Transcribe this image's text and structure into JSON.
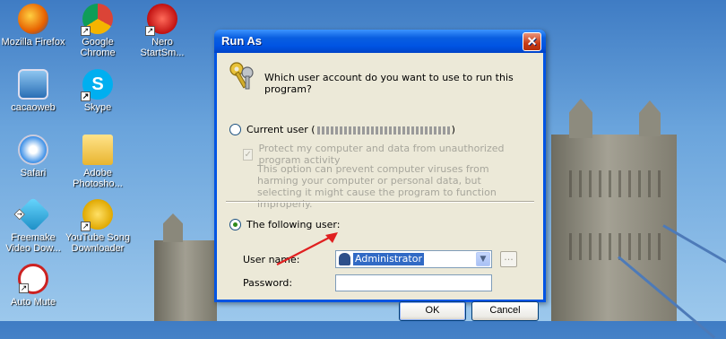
{
  "desktop": {
    "icons": [
      {
        "label_1": "Mozilla Firefox",
        "label_2": "",
        "icon": "firefox-icon",
        "color": "#e66000"
      },
      {
        "label_1": "Google",
        "label_2": "Chrome",
        "icon": "chrome-icon",
        "color": "#4caf50"
      },
      {
        "label_1": "Nero",
        "label_2": "StartSm...",
        "icon": "nero-icon",
        "color": "#d32f2f"
      },
      {
        "label_1": "cacaoweb",
        "label_2": "",
        "icon": "cacaoweb-icon",
        "color": "#2a6fb5"
      },
      {
        "label_1": "Skype",
        "label_2": "",
        "icon": "skype-icon",
        "color": "#00aff0"
      },
      {
        "label_1": "Safari",
        "label_2": "",
        "icon": "safari-icon",
        "color": "#3a8ee6"
      },
      {
        "label_1": "Adobe",
        "label_2": "Photosho...",
        "icon": "folder-icon",
        "color": "#f2c94c"
      },
      {
        "label_1": "Freemake",
        "label_2": "Video Dow...",
        "icon": "freemake-icon",
        "color": "#2bb3e6"
      },
      {
        "label_1": "YouTube Song",
        "label_2": "Downloader",
        "icon": "youtube-downloader-icon",
        "color": "#f4c20d"
      },
      {
        "label_1": "Auto Mute",
        "label_2": "",
        "icon": "auto-mute-icon",
        "color": "#cc2222"
      }
    ]
  },
  "dialog": {
    "title": "Run As",
    "close_glyph": "✕",
    "question": "Which user account do you want to use to run this program?",
    "current_user_label": "Current user (",
    "current_user_suffix": ")",
    "protect_label": "Protect my computer and data from unauthorized program activity",
    "protect_checked": true,
    "description": "This option can prevent computer viruses from harming your computer or personal data, but selecting it might cause the program to function improperly.",
    "following_user_label": "The following user:",
    "selected_option": "following_user",
    "username_label": "User name:",
    "username_value": "Administrator",
    "password_label": "Password:",
    "password_value": "",
    "browse_label": "...",
    "ok_label": "OK",
    "cancel_label": "Cancel"
  },
  "colors": {
    "titlebar": "#0054e3",
    "dialog_bg": "#ece9d8",
    "selection": "#316ac5",
    "arrow": "#e02020"
  }
}
